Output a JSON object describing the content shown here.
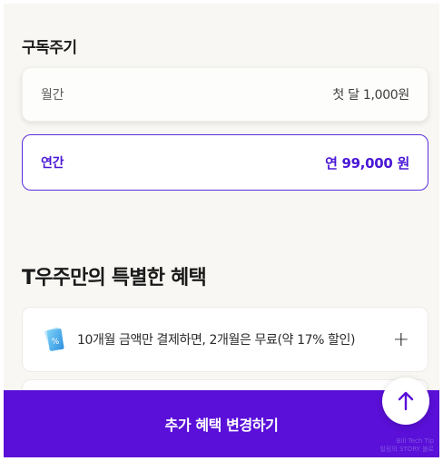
{
  "subscription": {
    "section_title": "구독주기",
    "options": [
      {
        "label": "월간",
        "price": "첫 달 1,000원"
      },
      {
        "label": "연간",
        "price": "연 99,000 원"
      }
    ]
  },
  "benefits": {
    "title": "T우주만의 특별한 혜택",
    "items": [
      {
        "text": "10개월 금액만 결제하면, 2개월은 무료(약 17% 할인)",
        "icon": "coupon-icon",
        "expand_icon": "plus-icon"
      }
    ]
  },
  "bottom_button": {
    "label": "추가 혜택 변경하기"
  },
  "scroll_top": {
    "icon": "arrow-up-icon"
  },
  "watermark": {
    "line1": "Bill Tech Tip",
    "line2": "빌링의 STORY 블로"
  },
  "colors": {
    "accent": "#5a10d8",
    "selected_border": "#5b2de0",
    "selected_text": "#4a17d6"
  }
}
